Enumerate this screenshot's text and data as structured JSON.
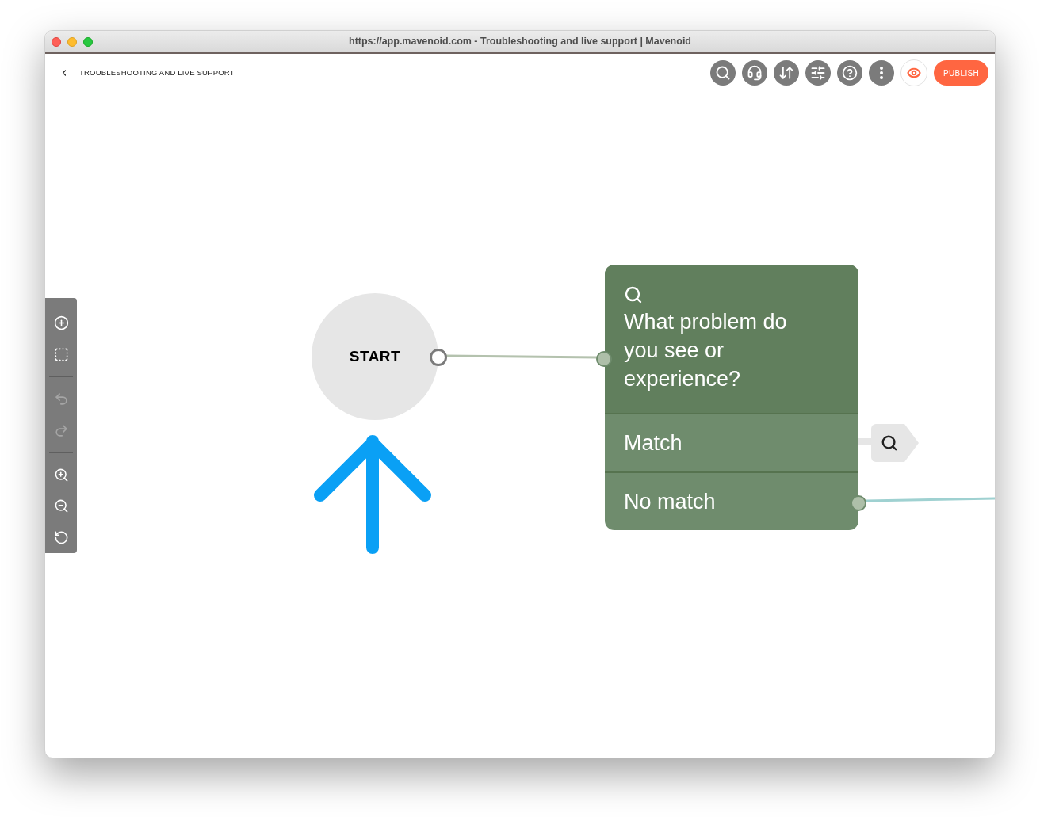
{
  "window": {
    "title": "https://app.mavenoid.com - Troubleshooting and live support | Mavenoid"
  },
  "header": {
    "title": "TROUBLESHOOTING AND LIVE SUPPORT",
    "publish": "PUBLISH"
  },
  "side_tools": [
    {
      "kind": "add",
      "disabled": false
    },
    {
      "kind": "select",
      "disabled": false
    },
    {
      "kind": "undo",
      "disabled": true
    },
    {
      "kind": "redo",
      "disabled": true
    },
    {
      "kind": "zoom_in",
      "disabled": false
    },
    {
      "kind": "zoom_out",
      "disabled": false
    },
    {
      "kind": "zoom_reset",
      "disabled": false
    }
  ],
  "canvas": {
    "start": "START",
    "question": {
      "text": "What problem do you see or experience?",
      "outputs": [
        {
          "label": "Match",
          "kind": "tag"
        },
        {
          "label": "No match",
          "kind": "connector"
        }
      ]
    }
  }
}
